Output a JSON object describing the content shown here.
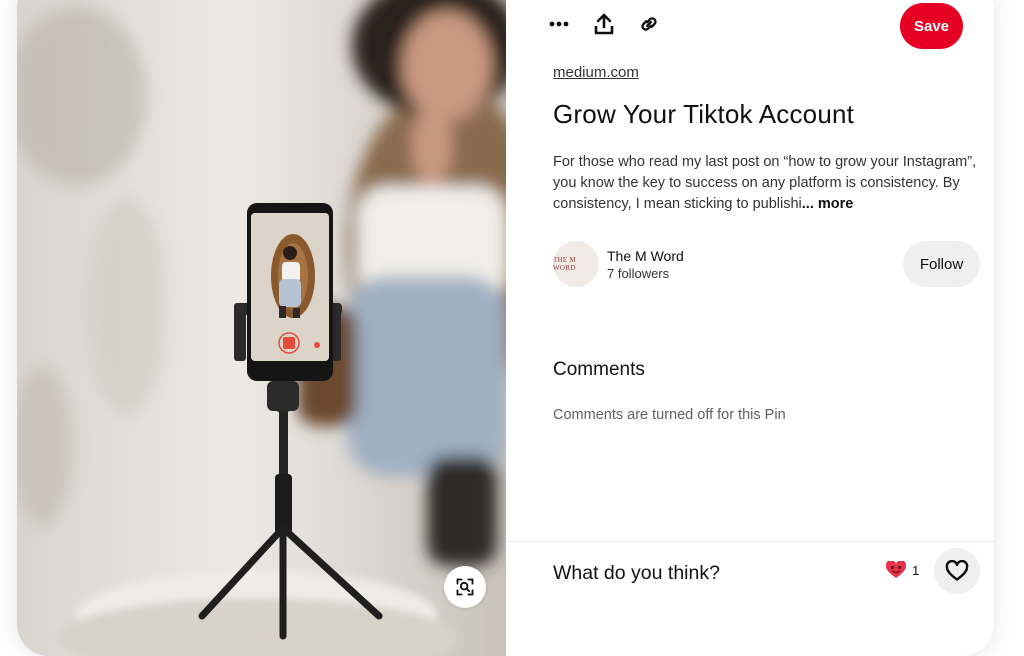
{
  "toolbar": {
    "more_icon": "more-options-icon",
    "share_icon": "share-icon",
    "link_icon": "link-icon",
    "save_label": "Save",
    "accent_color": "#e60023"
  },
  "pin": {
    "source": "medium.com",
    "title": "Grow Your Tiktok Account",
    "description": "For those who read my last post on “how to grow your Instagram”, you know the key to success on any platform is consistency. By consistency, I mean sticking to publishi",
    "more_label": "... more"
  },
  "creator": {
    "avatar_text": "THE M WORD",
    "name": "The M Word",
    "followers": "7 followers",
    "follow_label": "Follow"
  },
  "comments": {
    "heading": "Comments",
    "status": "Comments are turned off for this Pin"
  },
  "footer": {
    "prompt": "What do you think?",
    "reaction_count": "1",
    "reaction_icon": "heart-eyes-emoji-icon",
    "react_icon": "heart-outline-icon"
  },
  "image": {
    "lens_icon": "visual-search-icon"
  }
}
